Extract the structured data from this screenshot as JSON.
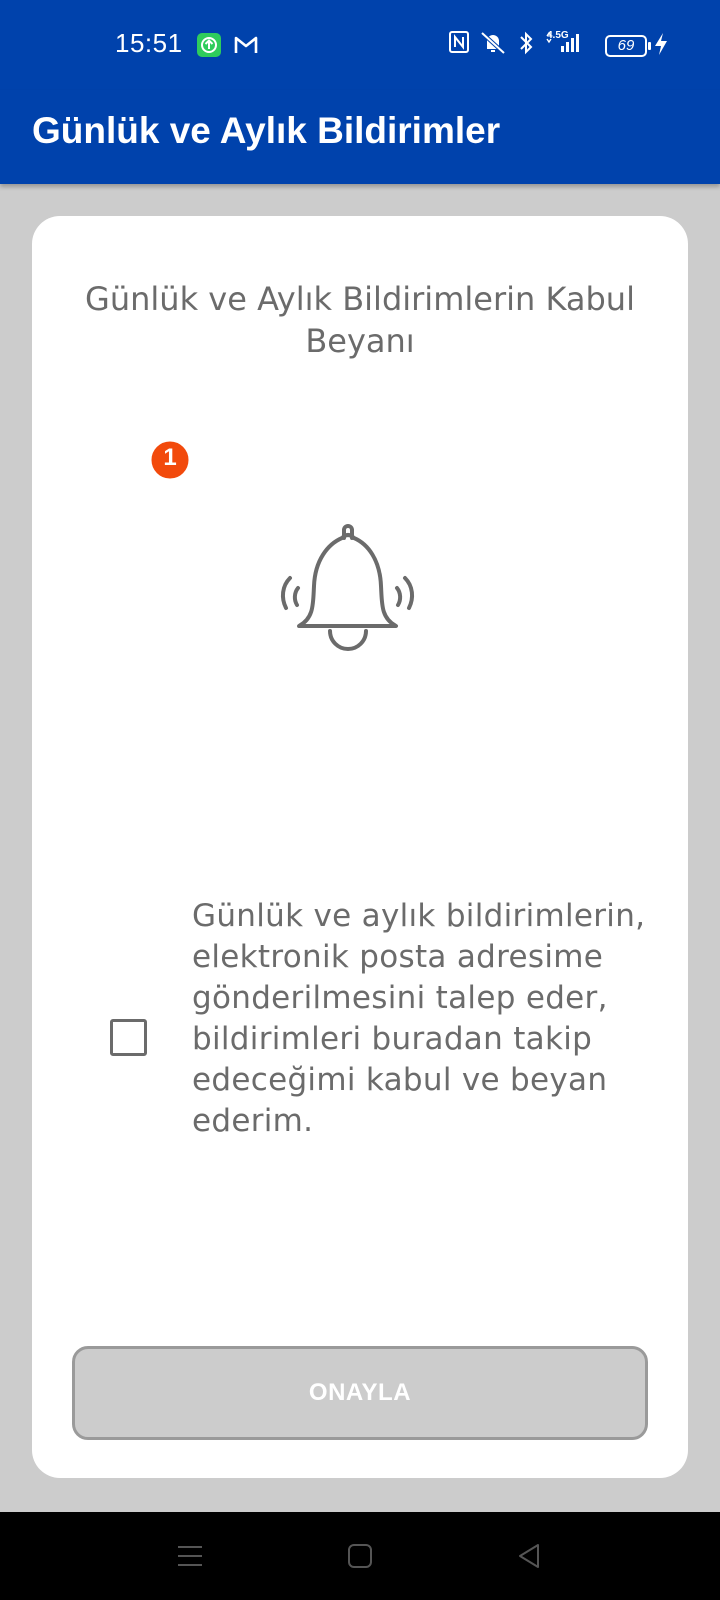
{
  "status_bar": {
    "time": "15:51",
    "battery_level": "69",
    "network_label": "4.5G",
    "icons": [
      "upload-app-icon",
      "gmail-icon",
      "nfc-icon",
      "muted-icon",
      "bluetooth-icon",
      "signal-icon",
      "battery-icon",
      "charging-icon"
    ]
  },
  "app_bar": {
    "title": "Günlük ve Aylık Bildirimler"
  },
  "card": {
    "title": "Günlük ve Aylık Bildirimlerin Kabul Beyanı",
    "illustration": "notification-bell-icon",
    "badge_count": "1",
    "consent_text": "Günlük ve aylık bildirimlerin, elektronik posta adresime gönderilmesini talep eder, bildirimleri buradan takip edeceğimi kabul ve beyan ederim.",
    "checkbox_checked": false,
    "confirm_label": "ONAYLA"
  },
  "colors": {
    "primary": "#0042AC",
    "background": "#cccccc",
    "text_gray": "#6b6b6b",
    "badge": "#F24A0C"
  },
  "nav_bar": {
    "items": [
      "menu-icon",
      "home-icon",
      "back-icon"
    ]
  }
}
